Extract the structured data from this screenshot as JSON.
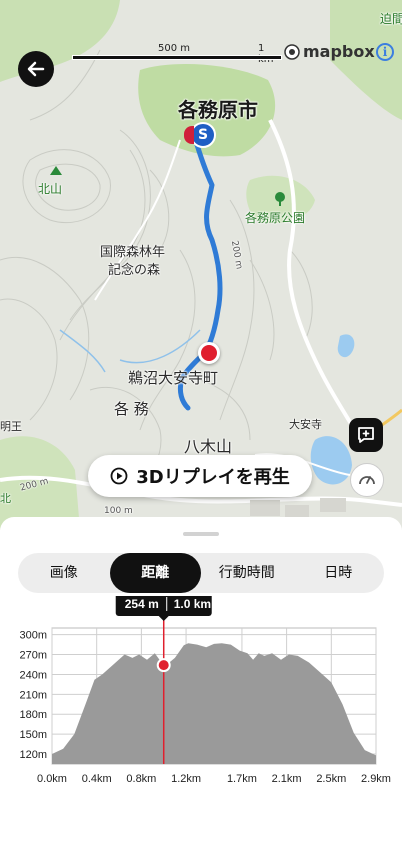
{
  "map": {
    "scale": {
      "label_500": "500 m",
      "label_1k": "1 km"
    },
    "attribution": "mapbox",
    "labels": {
      "city": "各務原市",
      "mountain_kita": "北山",
      "park": "各務原公園",
      "forest_line1": "国際森林年",
      "forest_line2": "記念の森",
      "town": "鵜沼大安寺町",
      "kakamu": "各 務",
      "yakiyama": "八木山",
      "daianji": "大安寺",
      "myoo": "明王",
      "contour_200_a": "200 m",
      "contour_200_b": "200 m",
      "contour_100": "100 m",
      "kita_right": "迫間",
      "north": "北"
    },
    "start_marker": "S",
    "replay_button": "3Dリプレイを再生"
  },
  "tabs": [
    "画像",
    "距離",
    "行動時間",
    "日時"
  ],
  "active_tab": "距離",
  "tooltip": {
    "elevation": "254",
    "elevation_unit": "m",
    "distance": "1.0",
    "distance_unit": "km"
  },
  "chart_data": {
    "type": "area",
    "xlabel": "",
    "ylabel": "",
    "x_ticks": [
      "0.0km",
      "0.4km",
      "0.8km",
      "1.2km",
      "1.7km",
      "2.1km",
      "2.5km",
      "2.9km"
    ],
    "y_ticks": [
      "300m",
      "270m",
      "240m",
      "210m",
      "180m",
      "150m",
      "120m"
    ],
    "xlim": [
      0,
      2.9
    ],
    "ylim": [
      105,
      310
    ],
    "x": [
      0.0,
      0.1,
      0.2,
      0.3,
      0.38,
      0.45,
      0.55,
      0.65,
      0.72,
      0.78,
      0.85,
      0.92,
      0.98,
      1.02,
      1.1,
      1.18,
      1.22,
      1.3,
      1.38,
      1.45,
      1.52,
      1.6,
      1.68,
      1.75,
      1.8,
      1.85,
      1.9,
      1.97,
      2.05,
      2.12,
      2.2,
      2.3,
      2.42,
      2.5,
      2.6,
      2.7,
      2.8,
      2.9
    ],
    "y": [
      120,
      128,
      150,
      195,
      232,
      240,
      255,
      270,
      265,
      270,
      262,
      272,
      258,
      254,
      265,
      284,
      287,
      285,
      281,
      286,
      287,
      285,
      276,
      272,
      262,
      272,
      268,
      272,
      262,
      270,
      268,
      258,
      240,
      228,
      195,
      152,
      126,
      118
    ],
    "cursor": {
      "x": 1.0,
      "y": 254
    }
  }
}
